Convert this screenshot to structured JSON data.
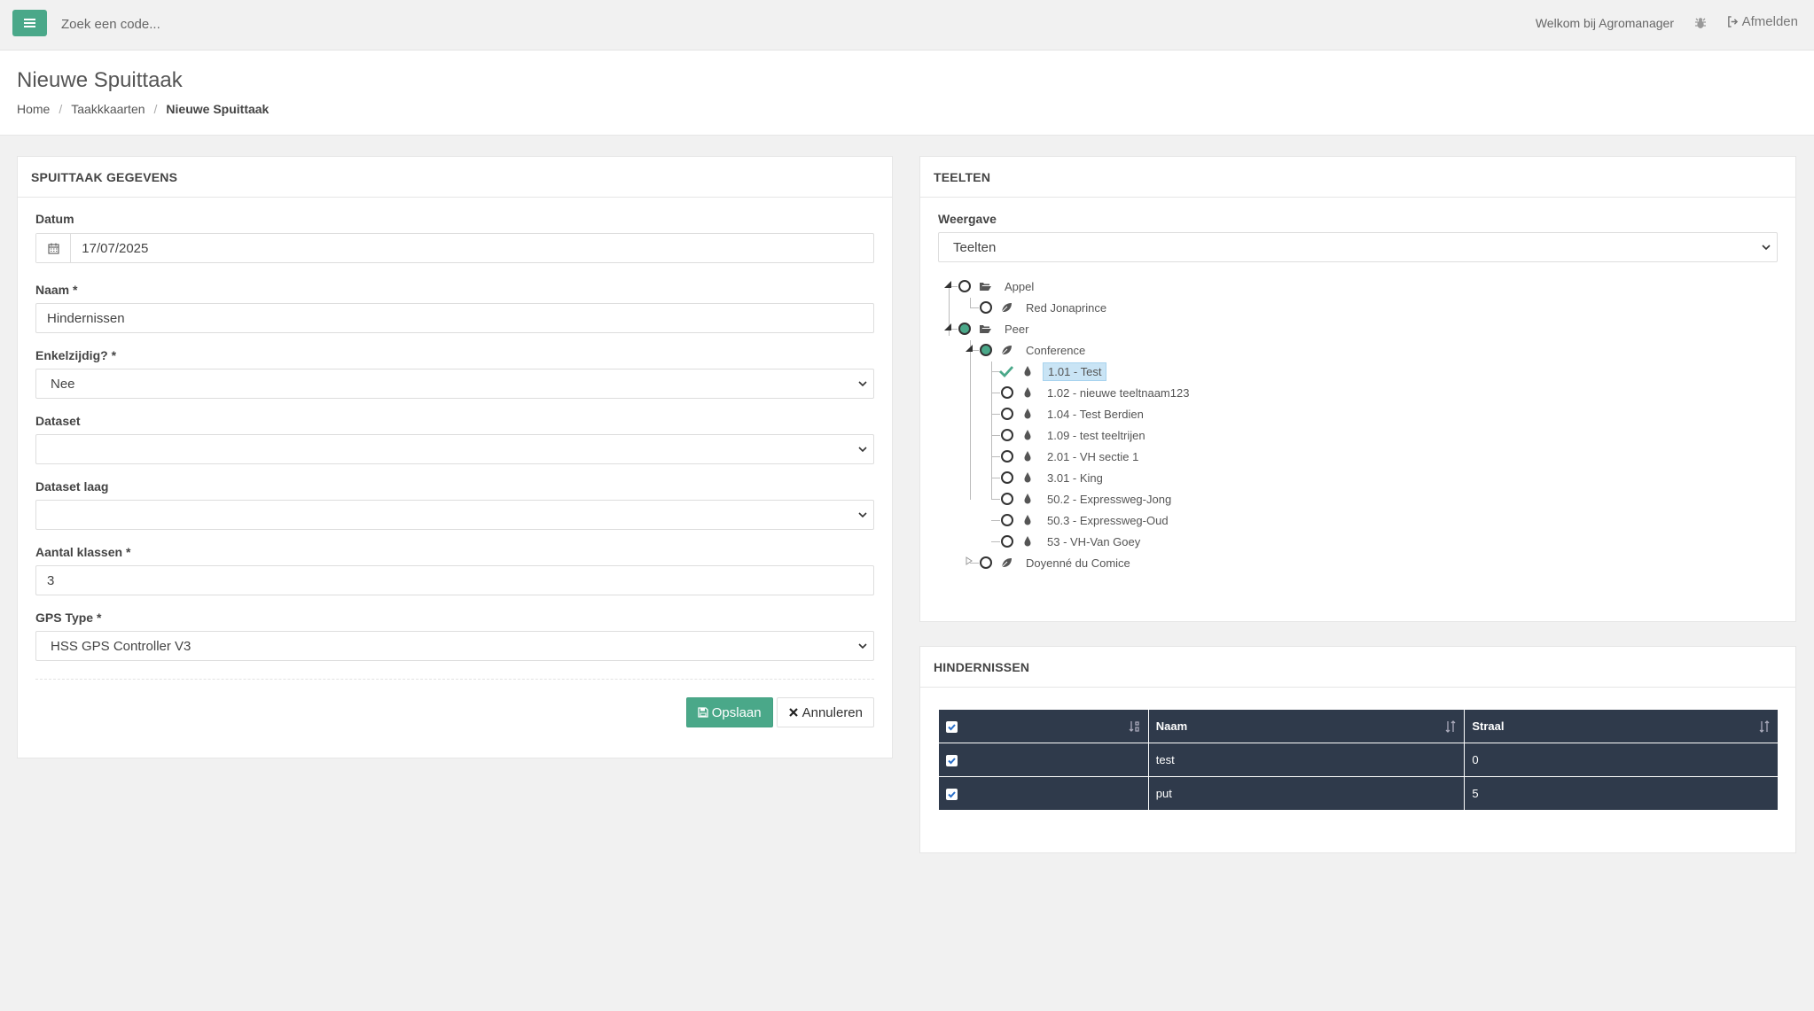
{
  "topbar": {
    "search_placeholder": "Zoek een code...",
    "welcome": "Welkom bij Agromanager",
    "logout": "Afmelden"
  },
  "header": {
    "title": "Nieuwe Spuittaak",
    "breadcrumb": [
      "Home",
      "Taakkkaarten",
      "Nieuwe Spuittaak"
    ]
  },
  "form": {
    "panel_title": "SPUITTAAK GEGEVENS",
    "datum_label": "Datum",
    "datum_value": "17/07/2025",
    "naam_label": "Naam *",
    "naam_value": "Hindernissen",
    "enkelzijdig_label": "Enkelzijdig? *",
    "enkelzijdig_value": "Nee",
    "dataset_label": "Dataset",
    "dataset_value": "",
    "dataset_laag_label": "Dataset laag",
    "dataset_laag_value": "",
    "klassen_label": "Aantal klassen *",
    "klassen_value": "3",
    "gps_label": "GPS Type *",
    "gps_value": "HSS GPS Controller V3",
    "save_label": "Opslaan",
    "cancel_label": "Annuleren"
  },
  "teelten": {
    "panel_title": "TEELTEN",
    "weergave_label": "Weergave",
    "weergave_value": "Teelten",
    "tree": {
      "appel": "Appel",
      "red_jonaprince": "Red Jonaprince",
      "peer": "Peer",
      "conference": "Conference",
      "items": [
        "1.01 - Test",
        "1.02 - nieuwe teeltnaam123",
        "1.04 - Test Berdien",
        "1.09 - test teeltrijen",
        "2.01 - VH sectie 1",
        "3.01 - King",
        "50.2 - Expressweg-Jong",
        "50.3 - Expressweg-Oud",
        "53 - VH-Van Goey"
      ],
      "doyenne": "Doyenné du Comice"
    }
  },
  "hindernissen": {
    "panel_title": "HINDERNISSEN",
    "columns": [
      "",
      "Naam",
      "Straal"
    ],
    "rows": [
      {
        "naam": "test",
        "straal": "0"
      },
      {
        "naam": "put",
        "straal": "5"
      }
    ]
  },
  "colors": {
    "accent": "#4aa889",
    "table_header": "#2f3a4b",
    "selected": "#c9e4f5"
  }
}
